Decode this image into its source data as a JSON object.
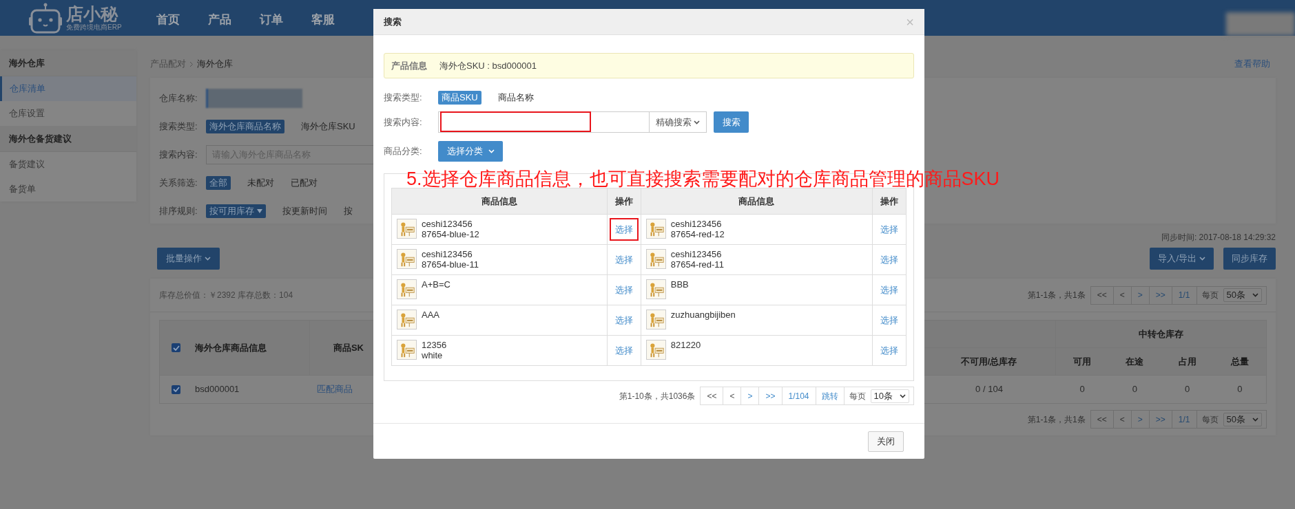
{
  "header": {
    "logo": {
      "name": "店小秘",
      "tagline": "免费跨境电商ERP"
    },
    "nav": [
      {
        "label": "首页"
      },
      {
        "label": "产品"
      },
      {
        "label": "订单"
      },
      {
        "label": "客服"
      }
    ]
  },
  "sidebar": {
    "sections": [
      {
        "title": "海外仓库",
        "items": [
          {
            "label": "仓库清单",
            "selected": true
          },
          {
            "label": "仓库设置",
            "selected": false
          }
        ]
      },
      {
        "title": "海外仓备货建议",
        "items": [
          {
            "label": "备货建议",
            "selected": false
          },
          {
            "label": "备货单",
            "selected": false
          }
        ]
      }
    ]
  },
  "breadcrumb": [
    "产品配对",
    "海外仓库"
  ],
  "help_link": "查看帮助",
  "filters": [
    {
      "kind": "redacted",
      "label": "仓库名称:"
    },
    {
      "kind": "options",
      "label": "搜索类型:",
      "options": [
        {
          "label": "海外仓库商品名称",
          "selected": true,
          "caret": false
        },
        {
          "label": "海外仓库SKU",
          "selected": false,
          "caret": false
        }
      ]
    },
    {
      "kind": "input",
      "label": "搜索内容:",
      "placeholder": "请输入海外仓库商品名称"
    },
    {
      "kind": "options",
      "label": "关系筛选:",
      "options": [
        {
          "label": "全部",
          "selected": true,
          "caret": false
        },
        {
          "label": "未配对",
          "selected": false,
          "caret": false
        },
        {
          "label": "已配对",
          "selected": false,
          "caret": false
        }
      ]
    },
    {
      "kind": "options",
      "label": "排序规则:",
      "options": [
        {
          "label": "按可用库存",
          "selected": true,
          "caret": true
        },
        {
          "label": "按更新时间",
          "selected": false,
          "caret": false
        },
        {
          "label": "按",
          "selected": false,
          "caret": false
        }
      ]
    }
  ],
  "sync_time": "同步时间: 2017-08-18 14:29:32",
  "bulk_button": "批量操作",
  "actions": [
    {
      "label": "导入/导出",
      "dropdown": true
    },
    {
      "label": "同步库存",
      "dropdown": false
    }
  ],
  "inventory": {
    "summary": "库存总价值：￥2392 库存总数：104",
    "pager_top": {
      "summary": "第1-1条，共1条",
      "buttons": [
        "<<",
        "<",
        ">",
        ">>"
      ],
      "page": "1/1",
      "per_page_label": "每页",
      "per_page": "50条"
    },
    "table": {
      "header_checked": true,
      "columns": [
        "海外仓库商品信息",
        "商品SK"
      ],
      "stock_column": "不可用/总库存",
      "group_header": "中转仓库存",
      "group_columns": [
        "可用",
        "在途",
        "占用",
        "总量"
      ],
      "rows": [
        {
          "checked": true,
          "sku": "bsd000001",
          "match": "匹配商品",
          "stock": "0 / 104",
          "group_values": [
            "0",
            "0",
            "0",
            "0"
          ]
        }
      ]
    },
    "pager_bottom": {
      "summary": "第1-1条，共1条",
      "buttons": [
        "<<",
        "<",
        ">",
        ">>"
      ],
      "page": "1/1",
      "per_page_label": "每页",
      "per_page": "50条"
    }
  },
  "modal": {
    "title": "搜索",
    "close": "×",
    "info": {
      "label": "产品信息",
      "value": "海外仓SKU : bsd000001"
    },
    "search_type": {
      "label": "搜索类型:",
      "options": [
        {
          "label": "商品SKU",
          "selected": true
        },
        {
          "label": "商品名称",
          "selected": false
        }
      ]
    },
    "search_content": {
      "label": "搜索内容:",
      "highlighted": true,
      "mode": "精确搜索",
      "button": "搜索"
    },
    "category": {
      "label": "商品分类:",
      "button": "选择分类"
    },
    "table": {
      "columns": [
        "商品信息",
        "操作",
        "商品信息",
        "操作"
      ],
      "rows": [
        [
          {
            "name": "ceshi123456",
            "variant": "87654-blue-12",
            "action": "选择",
            "highlighted": true
          },
          {
            "name": "ceshi123456",
            "variant": "87654-red-12",
            "action": "选择",
            "highlighted": false
          }
        ],
        [
          {
            "name": "ceshi123456",
            "variant": "87654-blue-11",
            "action": "选择",
            "highlighted": false
          },
          {
            "name": "ceshi123456",
            "variant": "87654-red-11",
            "action": "选择",
            "highlighted": false
          }
        ],
        [
          {
            "name": "A+B=C",
            "action": "选择",
            "highlighted": false
          },
          {
            "name": "BBB",
            "action": "选择",
            "highlighted": false
          }
        ],
        [
          {
            "name": "AAA",
            "action": "选择",
            "highlighted": false
          },
          {
            "name": "zuzhuangbijiben",
            "action": "选择",
            "highlighted": false
          }
        ],
        [
          {
            "name": "12356",
            "variant": "white",
            "action": "选择",
            "highlighted": false
          },
          {
            "name": "821220",
            "action": "选择",
            "highlighted": false
          }
        ]
      ]
    },
    "pager": {
      "summary": "第1-10条，共1036条",
      "buttons": [
        "<<",
        "<",
        ">",
        ">>"
      ],
      "page": "1/104",
      "jump": "跳转",
      "per_page_label": "每页",
      "per_page": "10条"
    },
    "close_button": "关闭"
  },
  "annotation": "5.选择仓库商品信息，也可直接搜索需要配对的仓库商品管理的商品SKU"
}
